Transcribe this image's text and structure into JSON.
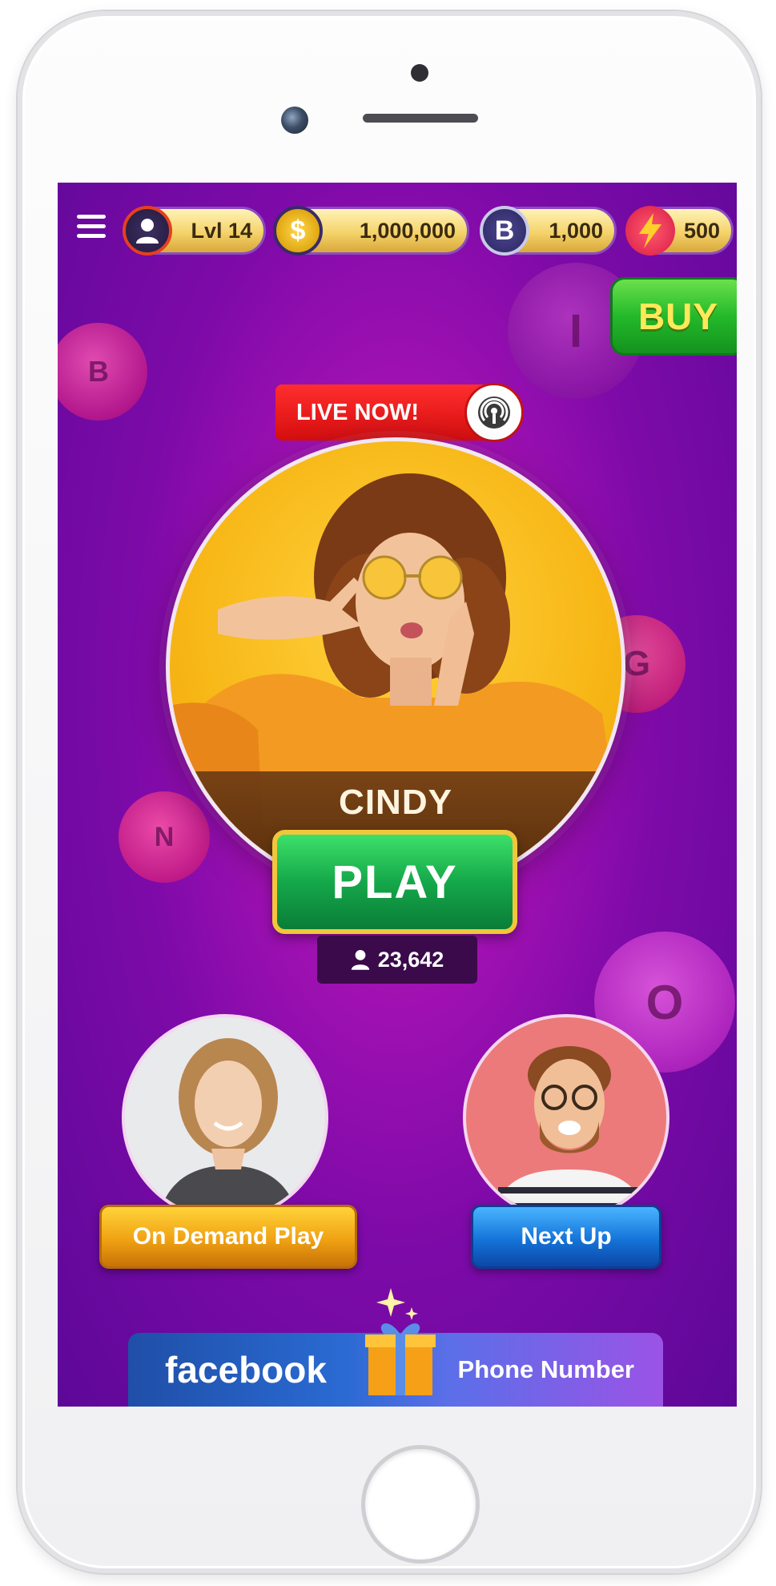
{
  "topbar": {
    "level": "Lvl 14",
    "coins": "1,000,000",
    "bingo_points": "1,000",
    "energy": "500",
    "icons": [
      "menu-icon",
      "user-icon",
      "dollar-coin-icon",
      "b-token-icon",
      "lightning-icon"
    ]
  },
  "buy_label": "BUY",
  "live": {
    "badge": "LIVE NOW!",
    "icon": "broadcast-icon"
  },
  "host": {
    "name": "CINDY"
  },
  "play_label": "PLAY",
  "players_count": "23,642",
  "modes": {
    "on_demand": "On Demand Play",
    "next_up": "Next Up"
  },
  "bottom": {
    "facebook": "facebook",
    "phone": "Phone Number"
  },
  "balls": [
    "B",
    "I",
    "N",
    "G",
    "O"
  ],
  "colors": {
    "screen_bg": "#a812b4",
    "play_green": "#15a84a",
    "buy_text": "#ffe85a",
    "live_red": "#d60e0e",
    "gold": "#f4d36a"
  }
}
